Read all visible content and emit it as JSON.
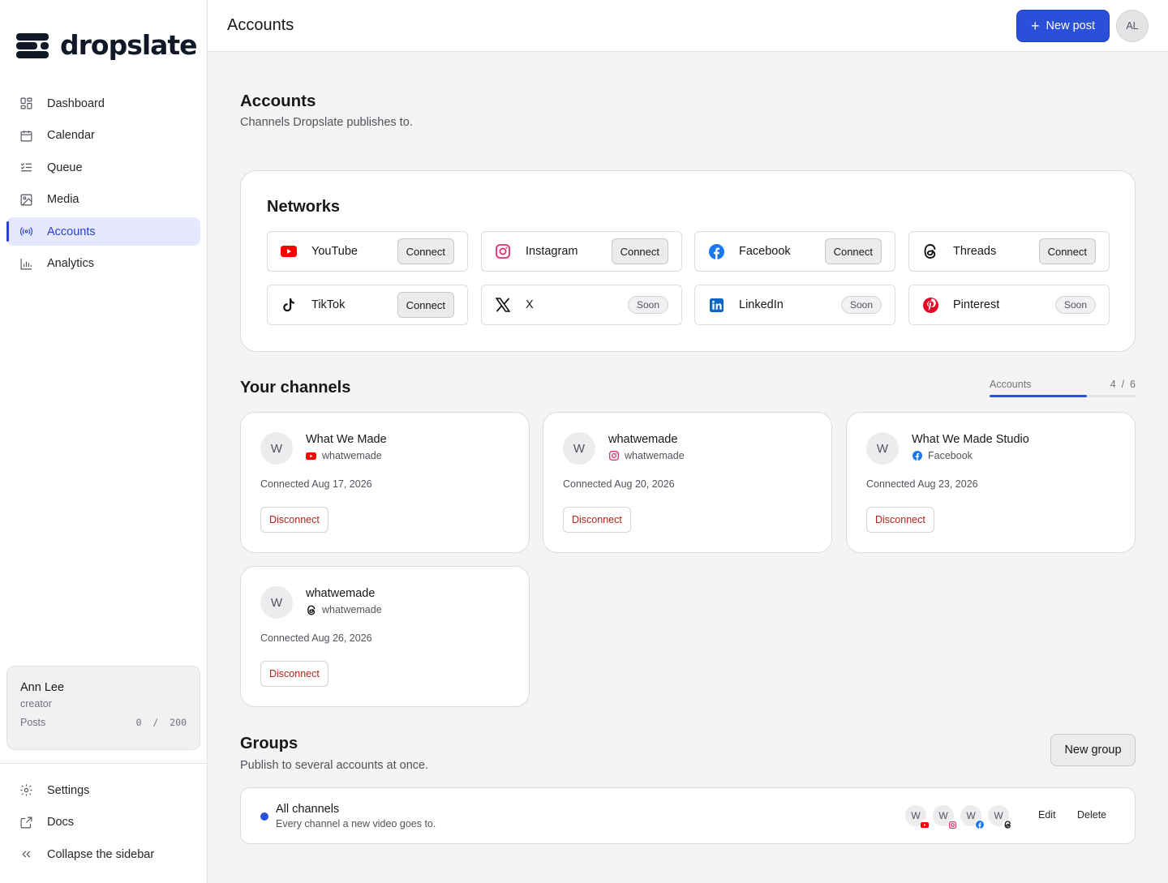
{
  "brand": {
    "name": "dropslate"
  },
  "sidebar": {
    "items": [
      {
        "label": "Dashboard",
        "icon": "dashboard-icon",
        "active": false
      },
      {
        "label": "Calendar",
        "icon": "calendar-icon",
        "active": false
      },
      {
        "label": "Queue",
        "icon": "queue-icon",
        "active": false
      },
      {
        "label": "Media",
        "icon": "image-icon",
        "active": false
      },
      {
        "label": "Accounts",
        "icon": "broadcast-icon",
        "active": true
      },
      {
        "label": "Analytics",
        "icon": "bar-chart-icon",
        "active": false
      }
    ],
    "user": {
      "name": "Ann Lee",
      "role": "creator",
      "posts_label": "Posts",
      "posts_used": "0",
      "posts_limit": "200",
      "posts_sep": "/"
    },
    "bottom": [
      {
        "label": "Settings",
        "icon": "gear-icon"
      },
      {
        "label": "Docs",
        "icon": "external-link-icon"
      },
      {
        "label": "Collapse the sidebar",
        "icon": "chevrons-left-icon"
      }
    ]
  },
  "header": {
    "title": "Accounts",
    "new_post_label": "New post",
    "avatar_initials": "AL"
  },
  "page": {
    "title": "Accounts",
    "subtitle": "Channels Dropslate publishes to."
  },
  "networks": {
    "title": "Networks",
    "items": [
      {
        "name": "YouTube",
        "icon": "youtube-icon",
        "action": "Connect",
        "status": "available"
      },
      {
        "name": "Instagram",
        "icon": "instagram-icon",
        "action": "Connect",
        "status": "available"
      },
      {
        "name": "Facebook",
        "icon": "facebook-icon",
        "action": "Connect",
        "status": "available"
      },
      {
        "name": "Threads",
        "icon": "threads-icon",
        "action": "Connect",
        "status": "available"
      },
      {
        "name": "TikTok",
        "icon": "tiktok-icon",
        "action": "Connect",
        "status": "available"
      },
      {
        "name": "X",
        "icon": "x-icon",
        "action": "Soon",
        "status": "soon"
      },
      {
        "name": "LinkedIn",
        "icon": "linkedin-icon",
        "action": "Soon",
        "status": "soon"
      },
      {
        "name": "Pinterest",
        "icon": "pinterest-icon",
        "action": "Soon",
        "status": "soon"
      }
    ]
  },
  "channels": {
    "title": "Your channels",
    "usage": {
      "label": "Accounts",
      "used": "4",
      "limit": "6",
      "sep": "/",
      "fraction": 0.667
    },
    "items": [
      {
        "initial": "W",
        "name": "What We Made",
        "network_icon": "youtube-icon",
        "handle": "whatwemade",
        "connected": "Connected Aug 17, 2026",
        "action": "Disconnect"
      },
      {
        "initial": "W",
        "name": "whatwemade",
        "network_icon": "instagram-icon",
        "handle": "whatwemade",
        "connected": "Connected Aug 20, 2026",
        "action": "Disconnect"
      },
      {
        "initial": "W",
        "name": "What We Made Studio",
        "network_icon": "facebook-icon",
        "handle": "Facebook",
        "connected": "Connected Aug 23, 2026",
        "action": "Disconnect"
      },
      {
        "initial": "W",
        "name": "whatwemade",
        "network_icon": "threads-icon",
        "handle": "whatwemade",
        "connected": "Connected Aug 26, 2026",
        "action": "Disconnect"
      }
    ]
  },
  "groups": {
    "title": "Groups",
    "subtitle": "Publish to several accounts at once.",
    "new_group_label": "New group",
    "items": [
      {
        "name": "All channels",
        "description": "Every channel a new video goes to.",
        "members": [
          {
            "initial": "W",
            "network_icon": "youtube-icon"
          },
          {
            "initial": "W",
            "network_icon": "instagram-icon"
          },
          {
            "initial": "W",
            "network_icon": "facebook-icon"
          },
          {
            "initial": "W",
            "network_icon": "threads-icon"
          }
        ],
        "edit_label": "Edit",
        "delete_label": "Delete"
      }
    ]
  },
  "colors": {
    "accent": "#2a4fd9",
    "danger": "#b42318",
    "youtube": "#ff0000",
    "instagram": "#e1306c",
    "facebook": "#1877f2",
    "linkedin": "#0a66c2",
    "pinterest": "#e60023"
  }
}
